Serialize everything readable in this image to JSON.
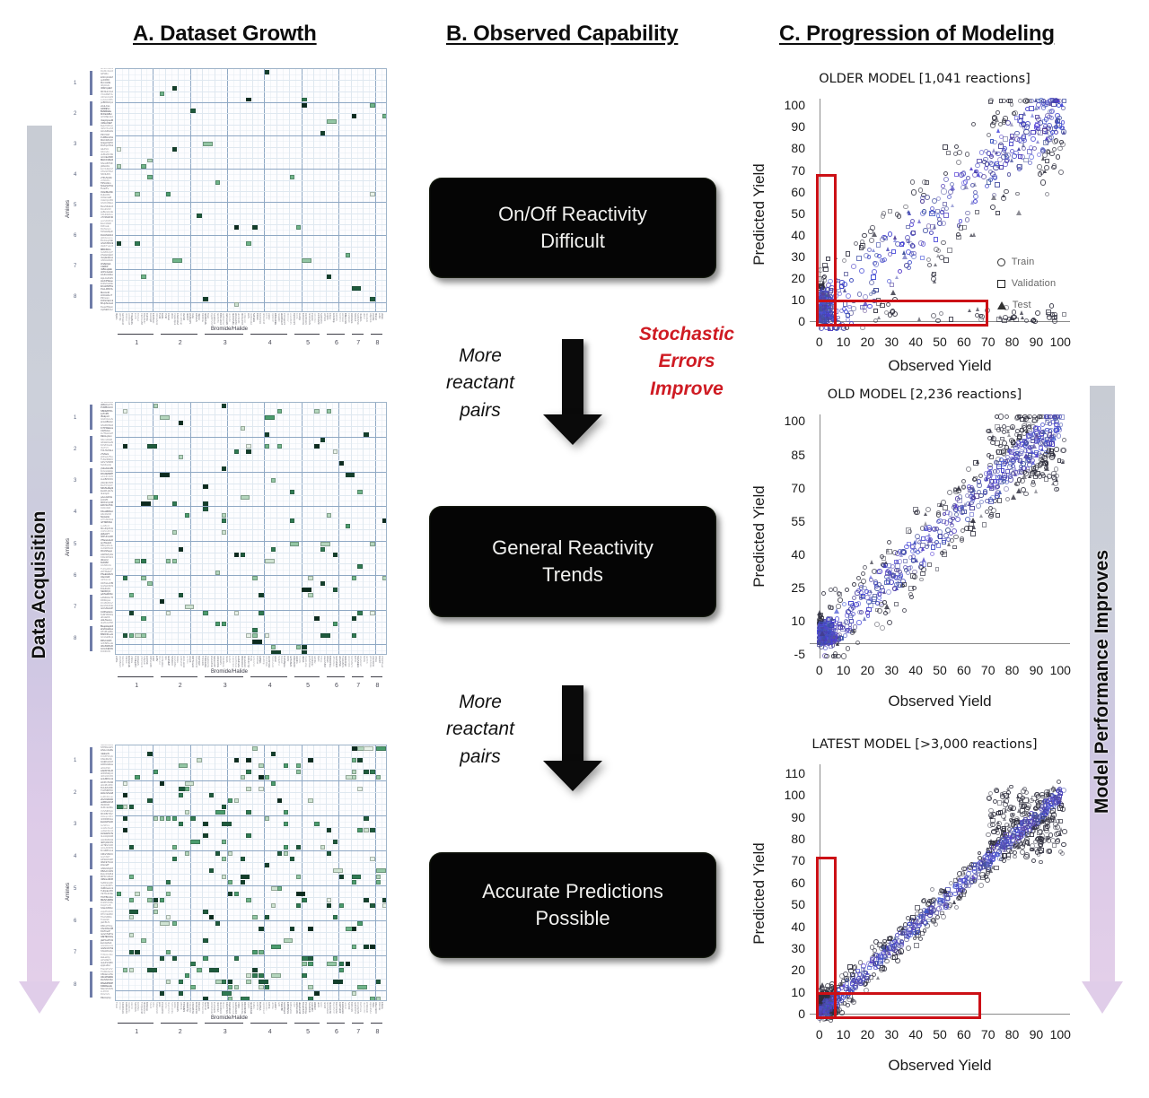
{
  "figure": {
    "panels": [
      {
        "id": "a",
        "title": "A. Dataset Growth"
      },
      {
        "id": "b",
        "title": "B. Observed Capability"
      },
      {
        "id": "c",
        "title": "C. Progression of Modeling"
      }
    ]
  },
  "arrows": {
    "left": {
      "label": "Data Acquisition",
      "color_start": "#c8ccd4",
      "color_end": "#e3cfe9"
    },
    "right": {
      "label": "Model Performance Improves",
      "color_start": "#c8ccd4",
      "color_end": "#e3cfe9"
    }
  },
  "panel_a": {
    "axis_x_label": "Bromide/Halide",
    "axis_y_label": "Amines",
    "column_groups": [
      "1",
      "2",
      "3",
      "4",
      "5",
      "6",
      "7",
      "8"
    ],
    "row_groups": [
      "1",
      "2",
      "3",
      "4",
      "5",
      "6",
      "7",
      "8"
    ],
    "grids": [
      {
        "name": "grid-early",
        "density": 0.022,
        "seed": 17
      },
      {
        "name": "grid-middle",
        "density": 0.055,
        "seed": 41
      },
      {
        "name": "grid-latest",
        "density": 0.105,
        "seed": 83
      }
    ]
  },
  "panel_b": {
    "boxes": [
      {
        "name": "on-off-reactivity",
        "text": "On/Off Reactivity\nDifficult"
      },
      {
        "name": "general-reactivity",
        "text": "General Reactivity\nTrends"
      },
      {
        "name": "accurate-predictions",
        "text": "Accurate Predictions\nPossible"
      }
    ],
    "arrows": [
      {
        "name": "arrow-1",
        "left_note": "More\nreactant\npairs",
        "right_note": "Stochastic\nErrors\nImprove",
        "right_note_color": "#cf1b23"
      },
      {
        "name": "arrow-2",
        "left_note": "More\nreactant\npairs",
        "right_note": "",
        "right_note_color": "#cf1b23"
      }
    ]
  },
  "chart_data": [
    {
      "type": "scatter",
      "name": "older-model",
      "title": "OLDER MODEL [1,041 reactions]",
      "xlabel": "Observed Yield",
      "ylabel": "Predicted Yield",
      "xticks": [
        0,
        10,
        20,
        30,
        40,
        50,
        60,
        70,
        80,
        90,
        100
      ],
      "yticks": [
        0,
        10,
        20,
        30,
        40,
        50,
        60,
        70,
        80,
        90,
        100
      ],
      "xlim": [
        -4,
        104
      ],
      "ylim": [
        -4,
        103
      ],
      "grid": false,
      "legend": {
        "position": "inside-right",
        "entries": [
          "Train",
          "Validation",
          "Test"
        ]
      },
      "series": [
        {
          "name": "Train",
          "marker": "circle",
          "color": "#3a3a55",
          "n": 520
        },
        {
          "name": "Validation",
          "marker": "square",
          "color": "#262636",
          "n": 150
        },
        {
          "name": "Test",
          "marker": "triangle",
          "color": "#2a2a3c",
          "n": 110
        }
      ],
      "annotation": {
        "type": "L-shaped-region",
        "color": "#cc1016",
        "vertical": {
          "x": [
            0,
            7
          ],
          "y": [
            0,
            68
          ]
        },
        "horizontal": {
          "x": [
            0,
            70
          ],
          "y": [
            0,
            10
          ]
        }
      },
      "correlation_note": "weak — large spread, many off-diagonal points"
    },
    {
      "type": "scatter",
      "name": "old-model",
      "title": "OLD MODEL [2,236 reactions]",
      "xlabel": "Observed Yield",
      "ylabel": "Predicted Yield",
      "xticks": [
        0,
        10,
        20,
        30,
        40,
        50,
        60,
        70,
        80,
        90,
        100
      ],
      "yticks": [
        -5,
        10,
        25,
        40,
        55,
        70,
        85,
        100
      ],
      "xlim": [
        -4,
        104
      ],
      "ylim": [
        -7,
        103
      ],
      "grid": false,
      "legend": null,
      "series": [
        {
          "name": "Train",
          "marker": "circle",
          "color": "#3a3a6a",
          "n": 760
        },
        {
          "name": "Validation",
          "marker": "square",
          "color": "#262636",
          "n": 190
        },
        {
          "name": "Test",
          "marker": "triangle",
          "color": "#2a2a3c",
          "n": 130
        }
      ],
      "annotation": null,
      "correlation_note": "moderate — diagonal band forming"
    },
    {
      "type": "scatter",
      "name": "latest-model",
      "title": "LATEST MODEL [>3,000 reactions]",
      "xlabel": "Observed Yield",
      "ylabel": "Predicted Yield",
      "xticks": [
        0,
        10,
        20,
        30,
        40,
        50,
        60,
        70,
        80,
        90,
        100
      ],
      "yticks": [
        0,
        10,
        20,
        30,
        40,
        50,
        60,
        70,
        80,
        90,
        100,
        110
      ],
      "xlim": [
        -4,
        104
      ],
      "ylim": [
        -4,
        114
      ],
      "grid": false,
      "legend": null,
      "series": [
        {
          "name": "Train",
          "marker": "circle",
          "color": "#3a3a7a",
          "n": 980
        },
        {
          "name": "Validation",
          "marker": "square",
          "color": "#20202e",
          "n": 200
        },
        {
          "name": "Test",
          "marker": "triangle",
          "color": "#2a2a3c",
          "n": 150
        }
      ],
      "annotation": {
        "type": "L-shaped-region",
        "color": "#cc1016",
        "vertical": {
          "x": [
            0,
            7
          ],
          "y": [
            0,
            72
          ]
        },
        "horizontal": {
          "x": [
            0,
            67
          ],
          "y": [
            0,
            10
          ]
        }
      },
      "correlation_note": "strong — tight diagonal correlation"
    }
  ]
}
